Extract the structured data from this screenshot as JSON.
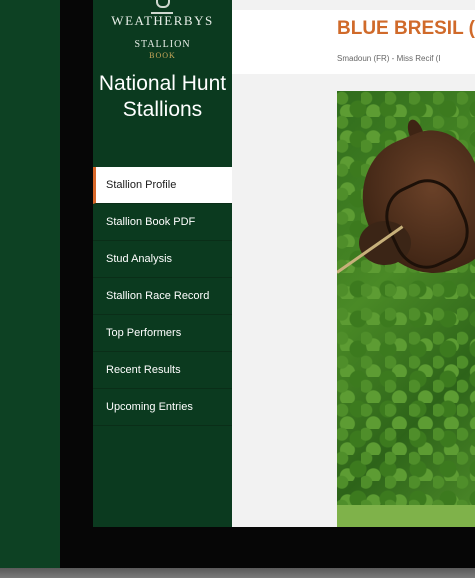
{
  "brand": {
    "name": "WEATHERBYS",
    "sub": "STALLION",
    "sub2": "BOOK"
  },
  "section_title": "National Hunt Stallions",
  "nav": [
    {
      "label": "Stallion Profile",
      "active": true
    },
    {
      "label": "Stallion Book PDF",
      "active": false
    },
    {
      "label": "Stud Analysis",
      "active": false
    },
    {
      "label": "Stallion Race Record",
      "active": false
    },
    {
      "label": "Top Performers",
      "active": false
    },
    {
      "label": "Recent Results",
      "active": false
    },
    {
      "label": "Upcoming Entries",
      "active": false
    }
  ],
  "stallion": {
    "name": "BLUE BRESIL (F",
    "pedigree": "Smadoun (FR) - Miss Recif (I"
  },
  "colors": {
    "accent": "#d06a2a",
    "sidebar": "#0b3a1f",
    "active_marker": "#d8682a"
  },
  "icons": {
    "logo": "crown-crest-icon"
  }
}
